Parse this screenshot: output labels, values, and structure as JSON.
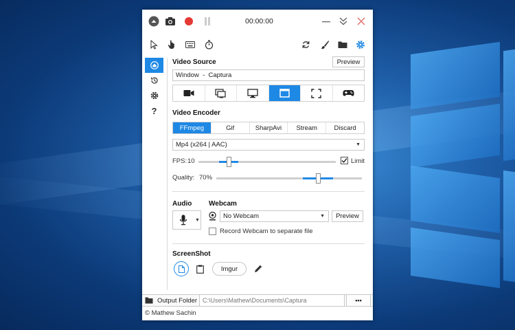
{
  "titlebar": {
    "time": "00:00:00"
  },
  "video_source": {
    "title": "Video Source",
    "preview_label": "Preview",
    "source_value": "Window  -  Captura"
  },
  "video_encoder": {
    "title": "Video Encoder",
    "tabs": [
      "FFmpeg",
      "Gif",
      "SharpAvi",
      "Stream",
      "Discard"
    ],
    "selected_tab": "FFmpeg",
    "codec": "Mp4 (x264 | AAC)",
    "fps_label": "FPS:",
    "fps_value": "10",
    "fps_level": 0.22,
    "limit_label": "Limit",
    "limit_checked": true,
    "quality_label": "Quality:",
    "quality_value": "70%",
    "quality_level": 0.7
  },
  "audio": {
    "title": "Audio"
  },
  "webcam": {
    "title": "Webcam",
    "value": "No Webcam",
    "preview_label": "Preview",
    "separate_label": "Record Webcam to separate file",
    "separate_checked": false
  },
  "screenshot": {
    "title": "ScreenShot",
    "imgur_label": "Imgur"
  },
  "output": {
    "folder_label": "Output Folder",
    "path": "C:\\Users\\Mathew\\Documents\\Captura",
    "more_label": "•••"
  },
  "footer": {
    "copyright": "© Mathew Sachin"
  },
  "colors": {
    "accent": "#1e88e5",
    "record": "#e53935",
    "close": "#e57373"
  }
}
